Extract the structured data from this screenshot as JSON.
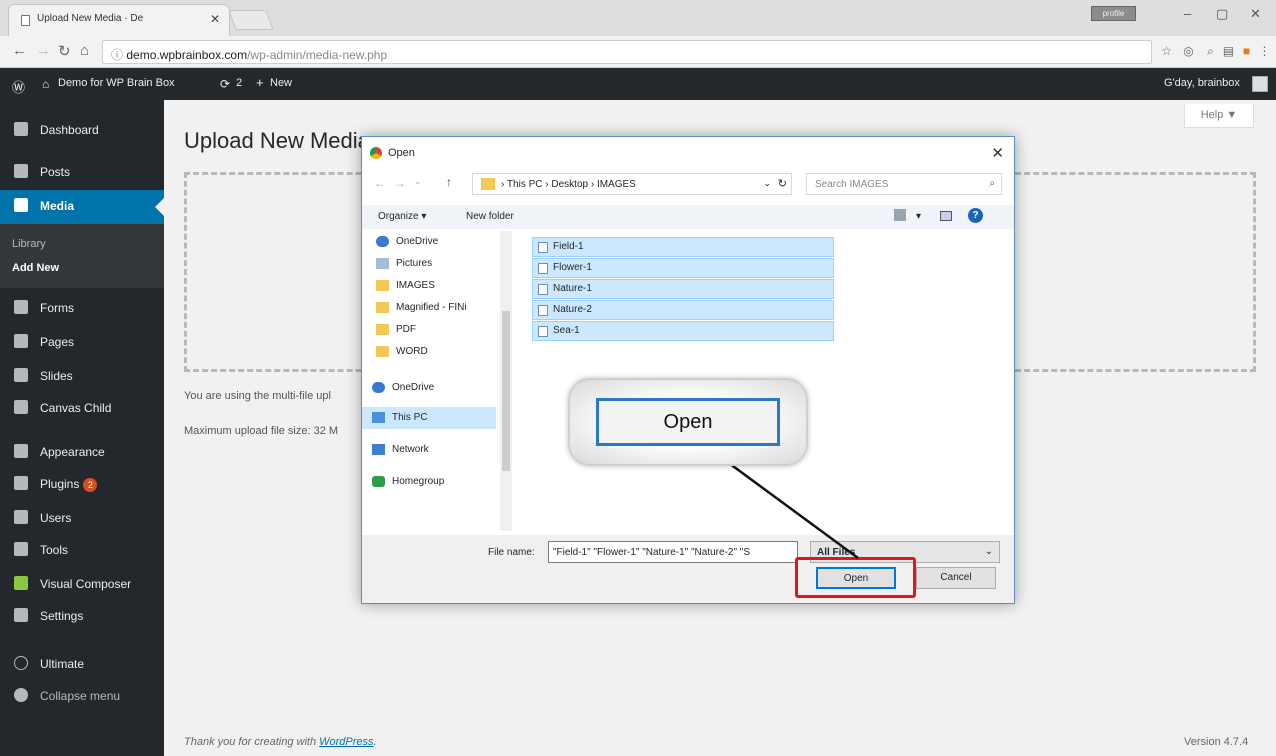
{
  "browser": {
    "tab_title": "Upload New Media · De",
    "tab_close": "✕",
    "profile_label": "profile",
    "minimize": "–",
    "restore": "▢",
    "close": "✕",
    "url_host": "demo.wpbrainbox.com",
    "url_path": "/wp-admin/media-new.php"
  },
  "admin_bar": {
    "site_name": "Demo for WP Brain Box",
    "updates_count": "2",
    "new_label": "New",
    "greeting": "G'day, brainbox"
  },
  "sidebar": {
    "dashboard": "Dashboard",
    "posts": "Posts",
    "media": "Media",
    "library": "Library",
    "add_new": "Add New",
    "forms": "Forms",
    "pages": "Pages",
    "slides": "Slides",
    "canvas_child": "Canvas Child",
    "appearance": "Appearance",
    "plugins": "Plugins",
    "plugins_badge": "2",
    "users": "Users",
    "tools": "Tools",
    "visual_composer": "Visual Composer",
    "settings": "Settings",
    "ultimate": "Ultimate",
    "collapse": "Collapse menu"
  },
  "main": {
    "help": "Help ▼",
    "title": "Upload New Media",
    "note1": "You are using the multi-file upl",
    "note2": "Maximum upload file size: 32 M",
    "footer_text": "Thank you for creating with ",
    "footer_link": "WordPress",
    "footer_period": ".",
    "version": "Version 4.7.4"
  },
  "dialog": {
    "title": "Open",
    "close": "✕",
    "path": "› This PC › Desktop › IMAGES",
    "search_placeholder": "Search IMAGES",
    "organize": "Organize ▾",
    "new_folder": "New folder",
    "nav_items": [
      "OneDrive",
      "Pictures",
      "IMAGES",
      "Magnified - FINi",
      "PDF",
      "WORD",
      "OneDrive",
      "This PC",
      "Network",
      "Homegroup"
    ],
    "files": [
      "Field-1",
      "Flower-1",
      "Nature-1",
      "Nature-2",
      "Sea-1"
    ],
    "file_name_label": "File name:",
    "file_name_value": "\"Field-1\" \"Flower-1\" \"Nature-1\" \"Nature-2\" \"S",
    "file_type": "All Files",
    "open": "Open",
    "cancel": "Cancel"
  },
  "callout": {
    "label": "Open"
  },
  "colors": {
    "wp_admin_dark": "#23282d",
    "wp_accent": "#0073aa",
    "highlight_red": "#e0151d",
    "selection_blue": "#cce8ff"
  }
}
